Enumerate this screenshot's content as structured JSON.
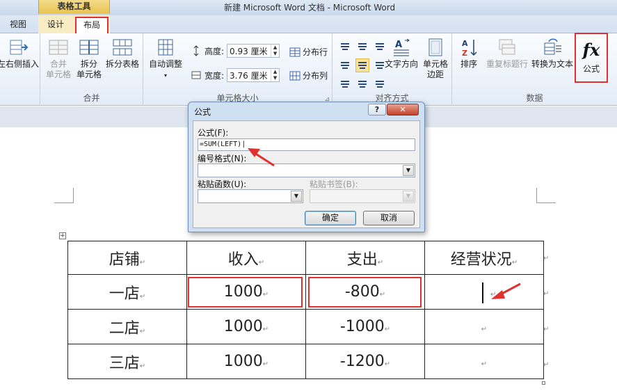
{
  "window": {
    "title": "新建 Microsoft Word 文档 - Microsoft Word",
    "context_group": "表格工具"
  },
  "tabs": {
    "view": "视图",
    "design": "设计",
    "layout": "布局"
  },
  "ribbon": {
    "insert_right": "左右侧插入",
    "merge_cells": [
      "合并",
      "单元格"
    ],
    "split_cells": [
      "拆分",
      "单元格"
    ],
    "split_table": "拆分表格",
    "group_merge": "合并",
    "autofit": "自动调整",
    "height_label": "高度:",
    "height_value": "0.93 厘米",
    "width_label": "宽度:",
    "width_value": "3.76 厘米",
    "distribute_rows": "分布行",
    "distribute_cols": "分布列",
    "group_cell_size": "单元格大小",
    "text_direction": "文字方向",
    "cell_margins": [
      "单元格",
      "边距"
    ],
    "group_alignment": "对齐方式",
    "sort": "排序",
    "repeat_header": "重复标题行",
    "convert_to_text": "转换为文本",
    "formula": "公式",
    "group_data": "数据",
    "launcher_glyph": "⊿"
  },
  "dialog": {
    "title": "公式",
    "help": "?",
    "close": "✕",
    "formula_label": "公式(F):",
    "formula_value": "=SUM(LEFT)|",
    "number_format_label": "编号格式(N):",
    "number_format_value": "",
    "paste_function_label": "粘贴函数(U):",
    "paste_bookmark_label": "粘贴书签(B):",
    "ok": "确定",
    "cancel": "取消"
  },
  "table": {
    "mark": "↵",
    "headers": [
      "店铺",
      "收入",
      "支出",
      "经营状况"
    ],
    "rows": [
      [
        "一店",
        "1000",
        "-800",
        ""
      ],
      [
        "二店",
        "1000",
        "-1000",
        ""
      ],
      [
        "三店",
        "1000",
        "-1200",
        ""
      ]
    ]
  },
  "colors": {
    "highlight": "#e03131",
    "context_tab": "#f4dc8a"
  }
}
